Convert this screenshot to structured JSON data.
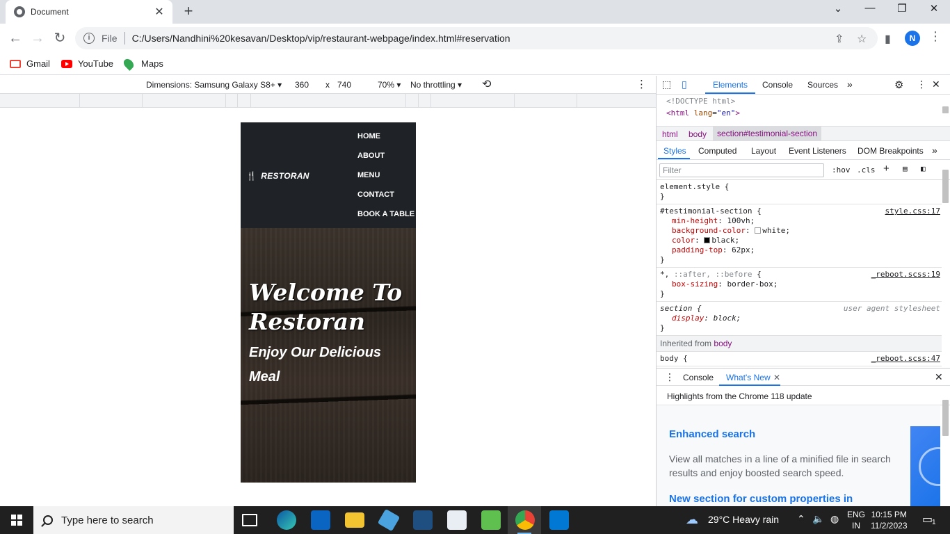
{
  "browser": {
    "tab_title": "Document",
    "address_scheme": "File",
    "url": "C:/Users/Nandhini%20kesavan/Desktop/vip/restaurant-webpage/index.html#reservation",
    "profile_initial": "N",
    "bookmarks": [
      {
        "label": "Gmail",
        "icon": "gmail-icon"
      },
      {
        "label": "YouTube",
        "icon": "youtube-icon"
      },
      {
        "label": "Maps",
        "icon": "maps-icon"
      }
    ]
  },
  "device_toolbar": {
    "dimensions": "Dimensions: Samsung Galaxy S8+ ▾",
    "width": "360",
    "times": "x",
    "height": "740",
    "zoom": "70% ▾",
    "throttling": "No throttling ▾"
  },
  "site": {
    "brand": "RESTORAN",
    "nav": [
      "HOME",
      "ABOUT",
      "MENU",
      "CONTACT",
      "BOOK A TABLE"
    ],
    "hero_title": "Welcome To Restoran",
    "hero_subtitle": "Enjoy Our Delicious Meal"
  },
  "devtools": {
    "tabs": [
      "Elements",
      "Console",
      "Sources"
    ],
    "more_tabs": "»",
    "dom_lines": {
      "doctype": "<!DOCTYPE html>",
      "html_open": "<html",
      "html_attr": "lang",
      "html_val": "\"en\"",
      "html_close": ">"
    },
    "breadcrumbs": [
      "html",
      "body",
      "section#testimonial-section"
    ],
    "subtabs": [
      "Styles",
      "Computed",
      "Layout",
      "Event Listeners",
      "DOM Breakpoints"
    ],
    "filter_placeholder": "Filter",
    "hov": ":hov",
    "cls": ".cls",
    "rules": {
      "element_style": "element.style {",
      "close": "}",
      "testimonial_selector": "#testimonial-section {",
      "testimonial_src": "style.css:17",
      "min_height_name": "min-height",
      "min_height_val": "100vh;",
      "bg_name": "background-color",
      "bg_val": "white;",
      "color_name": "color",
      "color_val": "black;",
      "padding_name": "padding-top",
      "padding_val": "62px;",
      "universal_selector_a": "*, ",
      "universal_selector_b": "::after, ::before",
      "universal_selector_c": " {",
      "reboot_src": "_reboot.scss:19",
      "box_sizing_name": "box-sizing",
      "box_sizing_val": "border-box;",
      "section_selector": "section {",
      "ua_label": "user agent stylesheet",
      "display_name": "display",
      "display_val": "block;",
      "inherited_label": "Inherited from",
      "inherited_from": "body",
      "body_selector": "body {",
      "body_src": "_reboot.scss:47"
    },
    "drawer": {
      "tabs": [
        "Console",
        "What's New"
      ],
      "highlights": "Highlights from the Chrome 118 update",
      "item1_title": "Enhanced search",
      "item1_text": "View all matches in a line of a minified file in search results and enjoy boosted search speed.",
      "item2_title": "New section for custom properties in"
    }
  },
  "taskbar": {
    "search_placeholder": "Type here to search",
    "weather": "29°C  Heavy rain",
    "lang_top": "ENG",
    "lang_bottom": "IN",
    "time": "10:15 PM",
    "date": "11/2/2023",
    "notifications": "1"
  }
}
